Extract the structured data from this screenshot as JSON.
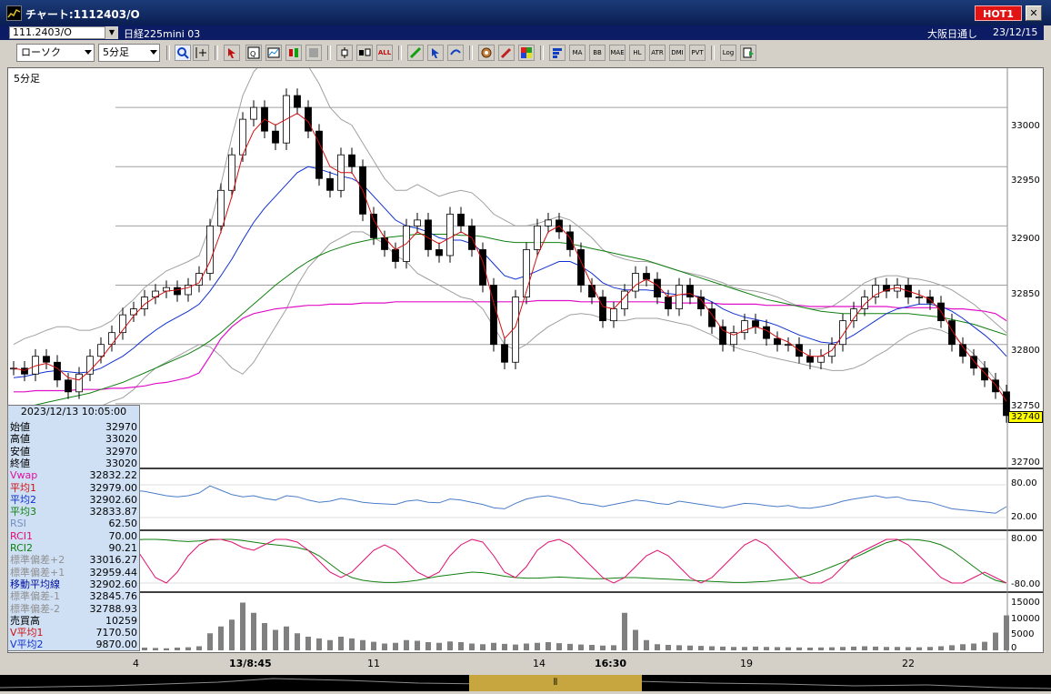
{
  "window": {
    "title": "チャート:1112403/O",
    "hot_label": "HOT1",
    "close_glyph": "✕"
  },
  "infobar": {
    "symbol": "111.2403/O",
    "instrument": "日経225mini 03",
    "right_label": "大阪日通し",
    "date": "23/12/15"
  },
  "toolbar": {
    "chart_type": "ローソク",
    "interval": "5分足",
    "tool_labels": [
      "MA",
      "BB",
      "MAE",
      "HL",
      "ATR",
      "DMI",
      "PVT",
      "Log"
    ]
  },
  "chart": {
    "panel_label": "5分足",
    "current_price": "32740",
    "price_ticks": [
      "33000",
      "32950",
      "32900",
      "32850",
      "32800",
      "32750",
      "32700"
    ],
    "rsi_ticks": [
      "80.00",
      "20.00"
    ],
    "rci_ticks": [
      "80.00",
      "-80.00"
    ],
    "volume_ticks": [
      "15000",
      "10000",
      "5000",
      "0"
    ]
  },
  "x_axis": {
    "labels": [
      {
        "text": "4",
        "bold": false
      },
      {
        "text": "13/8:45",
        "bold": true
      },
      {
        "text": "11",
        "bold": false
      },
      {
        "text": "14",
        "bold": false
      },
      {
        "text": "16:30",
        "bold": true
      },
      {
        "text": "19",
        "bold": false
      },
      {
        "text": "22",
        "bold": false
      }
    ]
  },
  "datapanel": {
    "timestamp": "2023/12/13 10:05:00",
    "rows": [
      {
        "k": "始値",
        "v": "32970",
        "c": "#000000"
      },
      {
        "k": "高値",
        "v": "33020",
        "c": "#000000"
      },
      {
        "k": "安値",
        "v": "32970",
        "c": "#000000"
      },
      {
        "k": "終値",
        "v": "33020",
        "c": "#000000"
      },
      {
        "k": "Vwap",
        "v": "32832.22",
        "c": "#e0109c"
      },
      {
        "k": "平均1",
        "v": "32979.00",
        "c": "#d01010"
      },
      {
        "k": "平均2",
        "v": "32902.60",
        "c": "#1030d0"
      },
      {
        "k": "平均3",
        "v": "32833.87",
        "c": "#108010"
      },
      {
        "k": "RSI",
        "v": "62.50",
        "c": "#7090c0"
      },
      {
        "k": "RCI1",
        "v": "70.00",
        "c": "#e01070"
      },
      {
        "k": "RCI2",
        "v": "90.21",
        "c": "#108010"
      },
      {
        "k": "標準偏差+2",
        "v": "33016.27",
        "c": "#909090"
      },
      {
        "k": "標準偏差+1",
        "v": "32959.44",
        "c": "#909090"
      },
      {
        "k": "移動平均線",
        "v": "32902.60",
        "c": "#0010a0"
      },
      {
        "k": "標準偏差-1",
        "v": "32845.76",
        "c": "#909090"
      },
      {
        "k": "標準偏差-2",
        "v": "32788.93",
        "c": "#909090"
      },
      {
        "k": "売買高",
        "v": "10259",
        "c": "#000000"
      },
      {
        "k": "V平均1",
        "v": "7170.50",
        "c": "#d01010"
      },
      {
        "k": "V平均2",
        "v": "9870.00",
        "c": "#1030d0"
      }
    ]
  },
  "colors": {
    "ma_short": "#d01010",
    "ma_mid": "#1030d0",
    "ma_long": "#108010",
    "vwap": "#e010c8",
    "band": "#a0a0a0",
    "rsi": "#4a7cc8",
    "rci_short": "#e01070",
    "rci_long": "#108010",
    "volume": "#808080"
  },
  "chart_data": {
    "type": "line",
    "price_ylim": [
      32700,
      33030
    ],
    "close": [
      32780,
      32775,
      32790,
      32785,
      32770,
      32760,
      32775,
      32790,
      32800,
      32810,
      32825,
      32830,
      32840,
      32845,
      32848,
      32842,
      32850,
      32860,
      32900,
      32930,
      32960,
      32990,
      33000,
      32980,
      32970,
      33010,
      33000,
      32980,
      32940,
      32930,
      32960,
      32950,
      32910,
      32890,
      32880,
      32870,
      32900,
      32905,
      32880,
      32875,
      32910,
      32900,
      32880,
      32850,
      32800,
      32785,
      32840,
      32880,
      32900,
      32905,
      32895,
      32880,
      32850,
      32840,
      32820,
      32830,
      32845,
      32860,
      32855,
      32840,
      32830,
      32850,
      32840,
      32830,
      32815,
      32800,
      32810,
      32820,
      32815,
      32805,
      32800,
      32800,
      32790,
      32785,
      32790,
      32800,
      32820,
      32830,
      32840,
      32850,
      32845,
      32850,
      32840,
      32840,
      32835,
      32820,
      32800,
      32790,
      32780,
      32770,
      32760,
      32740
    ],
    "ma1": [
      32780,
      32778,
      32782,
      32784,
      32780,
      32772,
      32770,
      32778,
      32788,
      32800,
      32812,
      32824,
      32834,
      32840,
      32845,
      32846,
      32848,
      32852,
      32870,
      32895,
      32925,
      32960,
      32980,
      32990,
      32985,
      32990,
      32995,
      32988,
      32970,
      32950,
      32945,
      32945,
      32930,
      32905,
      32890,
      32880,
      32885,
      32895,
      32890,
      32885,
      32890,
      32895,
      32890,
      32870,
      32835,
      32805,
      32815,
      32845,
      32875,
      32895,
      32900,
      32890,
      32870,
      32850,
      32832,
      32830,
      32840,
      32850,
      32855,
      32850,
      32840,
      32842,
      32843,
      32838,
      32825,
      32812,
      32808,
      32812,
      32815,
      32812,
      32806,
      32802,
      32795,
      32790,
      32790,
      32795,
      32808,
      32822,
      32834,
      32842,
      32846,
      32848,
      32845,
      32842,
      32838,
      32828,
      32812,
      32798,
      32786,
      32776,
      32766,
      32752
    ],
    "ma2": [
      32772,
      32773,
      32775,
      32777,
      32778,
      32777,
      32776,
      32777,
      32780,
      32785,
      32790,
      32797,
      32805,
      32812,
      32818,
      32823,
      32828,
      32834,
      32845,
      32858,
      32872,
      32888,
      32903,
      32915,
      32925,
      32935,
      32945,
      32950,
      32948,
      32945,
      32942,
      32940,
      32935,
      32925,
      32915,
      32905,
      32900,
      32898,
      32895,
      32890,
      32888,
      32888,
      32885,
      32878,
      32868,
      32858,
      32855,
      32858,
      32862,
      32866,
      32870,
      32870,
      32866,
      32860,
      32852,
      32848,
      32846,
      32846,
      32846,
      32845,
      32843,
      32842,
      32842,
      32840,
      32836,
      32830,
      32826,
      32823,
      32821,
      32819,
      32816,
      32812,
      32808,
      32805,
      32802,
      32801,
      32803,
      32808,
      32814,
      32820,
      32826,
      32830,
      32832,
      32834,
      32834,
      32832,
      32828,
      32822,
      32815,
      32808,
      32800,
      32790
    ],
    "ma3": [
      32745,
      32747,
      32749,
      32751,
      32753,
      32755,
      32757,
      32759,
      32762,
      32765,
      32768,
      32772,
      32776,
      32780,
      32784,
      32788,
      32792,
      32797,
      32803,
      32810,
      32818,
      32826,
      32834,
      32842,
      32850,
      32857,
      32864,
      32870,
      32875,
      32879,
      32882,
      32885,
      32887,
      32889,
      32890,
      32891,
      32892,
      32893,
      32893,
      32893,
      32893,
      32892,
      32892,
      32891,
      32889,
      32887,
      32886,
      32886,
      32886,
      32886,
      32886,
      32885,
      32883,
      32881,
      32879,
      32877,
      32875,
      32873,
      32871,
      32868,
      32865,
      32862,
      32859,
      32856,
      32853,
      32850,
      32847,
      32844,
      32841,
      32838,
      32836,
      32834,
      32832,
      32830,
      32828,
      32827,
      32826,
      32826,
      32826,
      32826,
      32826,
      32826,
      32826,
      32825,
      32824,
      32823,
      32821,
      32819,
      32817,
      32814,
      32811,
      32808
    ],
    "vwap": [
      32760,
      32760,
      32761,
      32761,
      32761,
      32761,
      32762,
      32762,
      32762,
      32763,
      32763,
      32764,
      32765,
      32767,
      32768,
      32770,
      32772,
      32776,
      32790,
      32805,
      32815,
      32822,
      32826,
      32828,
      32830,
      32831,
      32832,
      32833,
      32833,
      32834,
      32834,
      32834,
      32835,
      32835,
      32835,
      32836,
      32836,
      32836,
      32836,
      32836,
      32836,
      32836,
      32836,
      32836,
      32836,
      32836,
      32836,
      32836,
      32837,
      32837,
      32837,
      32837,
      32836,
      32836,
      32836,
      32836,
      32836,
      32836,
      32836,
      32836,
      32835,
      32835,
      32835,
      32835,
      32835,
      32834,
      32834,
      32834,
      32834,
      32833,
      32833,
      32833,
      32833,
      32832,
      32832,
      32832,
      32832,
      32832,
      32832,
      32832,
      32832,
      32831,
      32831,
      32831,
      32831,
      32831,
      32830,
      32830,
      32829,
      32828,
      32826,
      32820
    ],
    "bb_upper": [
      32800,
      32805,
      32808,
      32812,
      32815,
      32815,
      32812,
      32812,
      32815,
      32820,
      32830,
      32838,
      32848,
      32855,
      32862,
      32866,
      32870,
      32875,
      32900,
      32935,
      32975,
      33010,
      33030,
      33040,
      33038,
      33040,
      33040,
      33035,
      33020,
      33000,
      32990,
      32985,
      32970,
      32955,
      32940,
      32930,
      32930,
      32935,
      32930,
      32925,
      32928,
      32930,
      32928,
      32920,
      32910,
      32905,
      32900,
      32900,
      32902,
      32905,
      32908,
      32905,
      32898,
      32890,
      32880,
      32875,
      32872,
      32870,
      32870,
      32868,
      32865,
      32862,
      32860,
      32858,
      32855,
      32852,
      32848,
      32846,
      32845,
      32843,
      32840,
      32836,
      32832,
      32830,
      32830,
      32832,
      32838,
      32845,
      32852,
      32856,
      32858,
      32858,
      32856,
      32855,
      32853,
      32850,
      32846,
      32840,
      32834,
      32826,
      32818,
      32810
    ],
    "bb_lower": [
      32745,
      32742,
      32743,
      32744,
      32742,
      32740,
      32740,
      32742,
      32748,
      32752,
      32755,
      32762,
      32772,
      32780,
      32785,
      32790,
      32795,
      32800,
      32798,
      32790,
      32780,
      32775,
      32785,
      32800,
      32815,
      32830,
      32850,
      32865,
      32875,
      32885,
      32890,
      32895,
      32895,
      32890,
      32885,
      32875,
      32870,
      32860,
      32855,
      32850,
      32845,
      32840,
      32838,
      32830,
      32815,
      32800,
      32795,
      32800,
      32808,
      32815,
      32820,
      32825,
      32826,
      32825,
      32822,
      32820,
      32820,
      32822,
      32822,
      32822,
      32820,
      32818,
      32816,
      32812,
      32808,
      32802,
      32798,
      32795,
      32793,
      32790,
      32788,
      32786,
      32784,
      32782,
      32780,
      32778,
      32778,
      32780,
      32784,
      32790,
      32795,
      32802,
      32808,
      32812,
      32814,
      32812,
      32808,
      32800,
      32792,
      32782,
      32770,
      32756
    ],
    "rsi": [
      60,
      55,
      58,
      52,
      50,
      48,
      52,
      56,
      58,
      62,
      66,
      70,
      68,
      64,
      60,
      58,
      60,
      65,
      78,
      70,
      62,
      58,
      60,
      55,
      52,
      60,
      58,
      52,
      48,
      50,
      55,
      52,
      48,
      46,
      45,
      44,
      50,
      52,
      48,
      47,
      54,
      52,
      48,
      44,
      38,
      36,
      46,
      54,
      58,
      60,
      56,
      52,
      46,
      44,
      40,
      44,
      48,
      52,
      50,
      46,
      44,
      50,
      47,
      44,
      41,
      38,
      42,
      46,
      45,
      42,
      40,
      42,
      38,
      37,
      40,
      44,
      50,
      54,
      57,
      60,
      56,
      58,
      52,
      50,
      48,
      42,
      36,
      34,
      32,
      30,
      28,
      40
    ],
    "rci1": [
      80,
      70,
      60,
      20,
      -40,
      -60,
      -20,
      40,
      70,
      80,
      80,
      60,
      0,
      -60,
      -80,
      -40,
      20,
      60,
      80,
      80,
      70,
      50,
      40,
      60,
      80,
      80,
      70,
      40,
      0,
      -40,
      -60,
      -40,
      0,
      40,
      60,
      40,
      0,
      -40,
      -60,
      -40,
      20,
      60,
      80,
      70,
      20,
      -40,
      -60,
      -20,
      40,
      70,
      80,
      60,
      20,
      -20,
      -60,
      -80,
      -60,
      -20,
      20,
      40,
      20,
      -20,
      -60,
      -80,
      -60,
      -20,
      20,
      60,
      80,
      60,
      20,
      -20,
      -60,
      -80,
      -80,
      -60,
      -20,
      20,
      40,
      60,
      80,
      80,
      60,
      20,
      -20,
      -60,
      -80,
      -80,
      -60,
      -40,
      -60,
      -80
    ],
    "rci2": [
      60,
      70,
      75,
      78,
      75,
      70,
      66,
      64,
      66,
      70,
      74,
      78,
      80,
      80,
      78,
      74,
      72,
      74,
      78,
      80,
      80,
      76,
      70,
      64,
      60,
      56,
      50,
      40,
      20,
      -10,
      -40,
      -60,
      -70,
      -75,
      -78,
      -78,
      -75,
      -70,
      -62,
      -55,
      -50,
      -45,
      -40,
      -42,
      -48,
      -55,
      -60,
      -62,
      -62,
      -60,
      -58,
      -60,
      -62,
      -64,
      -64,
      -62,
      -60,
      -60,
      -62,
      -64,
      -66,
      -68,
      -70,
      -72,
      -74,
      -76,
      -78,
      -78,
      -76,
      -74,
      -70,
      -66,
      -60,
      -50,
      -36,
      -20,
      -4,
      12,
      30,
      50,
      68,
      78,
      80,
      78,
      72,
      60,
      40,
      10,
      -20,
      -50,
      -70,
      -80
    ],
    "volume": [
      800,
      700,
      900,
      600,
      500,
      700,
      800,
      900,
      1000,
      1200,
      1000,
      900,
      800,
      700,
      600,
      800,
      900,
      1200,
      5000,
      7000,
      9000,
      14000,
      11000,
      8000,
      6000,
      7000,
      5000,
      4000,
      3500,
      3000,
      4000,
      3500,
      3000,
      2500,
      2000,
      2200,
      3000,
      2800,
      2400,
      2200,
      2600,
      2400,
      2000,
      1800,
      2200,
      1900,
      1700,
      2000,
      2200,
      2400,
      2100,
      1900,
      1700,
      1600,
      1400,
      1500,
      11000,
      6000,
      3000,
      1800,
      1600,
      1500,
      1400,
      1300,
      1200,
      1100,
      1000,
      1000,
      1100,
      1000,
      950,
      900,
      850,
      800,
      850,
      900,
      1000,
      1100,
      1200,
      1100,
      1000,
      1000,
      950,
      900,
      1000,
      1200,
      1500,
      1800,
      2000,
      2500,
      5200,
      10259
    ],
    "vol_ylim": [
      0,
      16000
    ]
  }
}
